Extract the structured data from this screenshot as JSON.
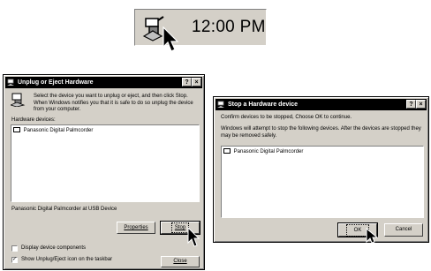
{
  "tray": {
    "clock": "12:00 PM",
    "icon": "unplug-eject-hardware-icon"
  },
  "unplug_dialog": {
    "title": "Unplug or Eject Hardware",
    "help_button": "?",
    "close_button": "×",
    "instructions": "Select the device you want to unplug or eject, and then click Stop. When Windows notifies you that it is safe to do so unplug the device from your computer.",
    "hardware_devices_label": "Hardware devices:",
    "devices": [
      "Panasonic Digital Palmcorder"
    ],
    "device_location": "Panasonic Digital Palmcorder at USB Device",
    "properties_button": "Properties",
    "stop_button": "Stop",
    "display_components_label": "Display device components",
    "display_components_checked": false,
    "show_icon_label": "Show Unplug/Eject icon on the taskbar",
    "show_icon_checked": true,
    "close_label": "Close"
  },
  "stop_dialog": {
    "title": "Stop a Hardware device",
    "help_button": "?",
    "close_button": "×",
    "confirm_text": "Confirm devices to be stopped, Choose OK to continue.",
    "info_text": "Windows will attempt to stop the following devices. After the devices are stopped they may be removed safely.",
    "devices": [
      "Panasonic Digital Palmcorder"
    ],
    "ok_button": "OK",
    "cancel_button": "Cancel"
  }
}
